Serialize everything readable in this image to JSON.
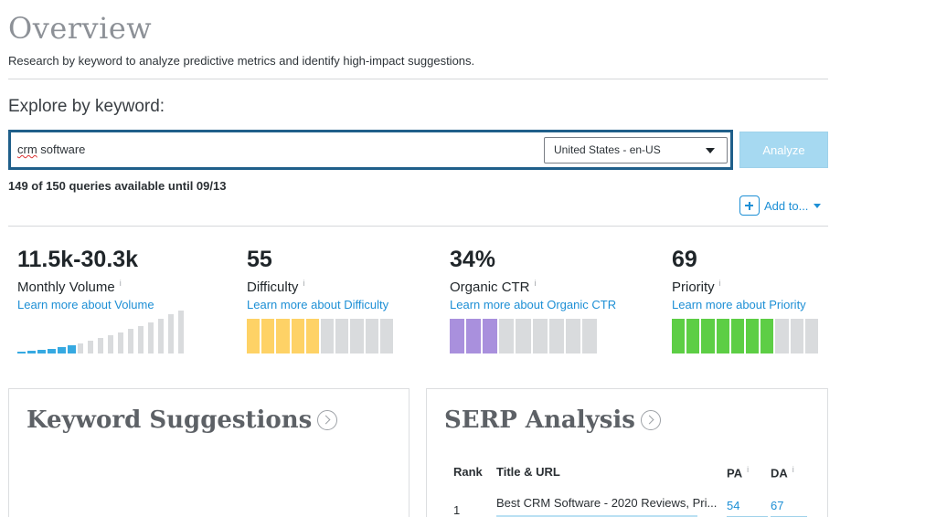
{
  "header": {
    "title": "Overview",
    "subtitle": "Research by keyword to analyze predictive metrics and identify high-impact suggestions."
  },
  "explore": {
    "label": "Explore by keyword:",
    "query_misspelled": "crm",
    "query_rest": " software",
    "locale": "United States - en-US",
    "analyze_label": "Analyze",
    "quota": "149 of 150 queries available until 09/13",
    "add_to_label": "Add to..."
  },
  "metrics": {
    "volume": {
      "value": "11.5k-30.3k",
      "name": "Monthly Volume",
      "info": "i",
      "learn": "Learn more about Volume"
    },
    "difficulty": {
      "value": "55",
      "name": "Difficulty",
      "info": "i",
      "learn": "Learn more about Difficulty",
      "filled_segments": 5,
      "total_segments": 10,
      "color": "#fed266"
    },
    "ctr": {
      "value": "34%",
      "name": "Organic CTR",
      "info": "i",
      "learn": "Learn more about Organic CTR",
      "filled_segments": 3,
      "total_segments": 9,
      "color": "#a990dd"
    },
    "priority": {
      "value": "69",
      "name": "Priority",
      "info": "i",
      "learn": "Learn more about Priority",
      "filled_segments": 7,
      "total_segments": 10,
      "color": "#5dce45"
    }
  },
  "volume_bars": {
    "count": 17,
    "filled": 6,
    "filled_color": "#36a9e1",
    "empty_color": "#d9dbdd"
  },
  "keyword_suggestions": {
    "title": "Keyword Suggestions"
  },
  "serp": {
    "title": "SERP Analysis",
    "columns": {
      "rank": "Rank",
      "title": "Title & URL",
      "pa": "PA",
      "da": "DA"
    },
    "column_info": "i",
    "rows": [
      {
        "rank": "1",
        "title": "Best CRM Software - 2020 Reviews, Pri...",
        "pa": "54",
        "da": "67"
      }
    ]
  },
  "colors": {
    "accent": "#1d8fd5",
    "search_border": "#1f5f8a",
    "empty_segment": "#d9dbdd"
  }
}
